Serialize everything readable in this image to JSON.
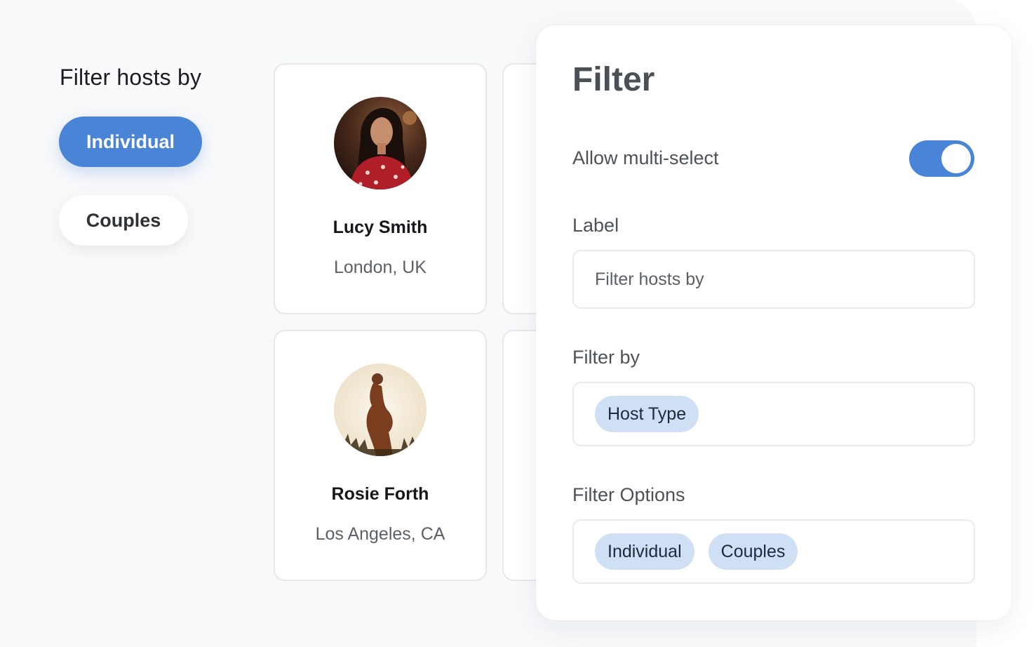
{
  "sidebar": {
    "heading": "Filter hosts by",
    "options": [
      {
        "label": "Individual",
        "selected": true
      },
      {
        "label": "Couples",
        "selected": false
      }
    ]
  },
  "hosts": [
    {
      "name": "Lucy Smith",
      "location": "London, UK"
    },
    {
      "name": "Rosie Forth",
      "location": "Los Angeles, CA"
    }
  ],
  "panel": {
    "title": "Filter",
    "multi_select_label": "Allow multi-select",
    "multi_select_enabled": true,
    "label_field_label": "Label",
    "label_field_value": "Filter hosts by",
    "filter_by_label": "Filter by",
    "filter_by_chips": [
      "Host Type"
    ],
    "filter_options_label": "Filter Options",
    "filter_option_chips": [
      "Individual",
      "Couples"
    ]
  },
  "colors": {
    "accent": "#4a84d6",
    "chip": "#cfdff4",
    "canvas": "#f8f9fb"
  }
}
